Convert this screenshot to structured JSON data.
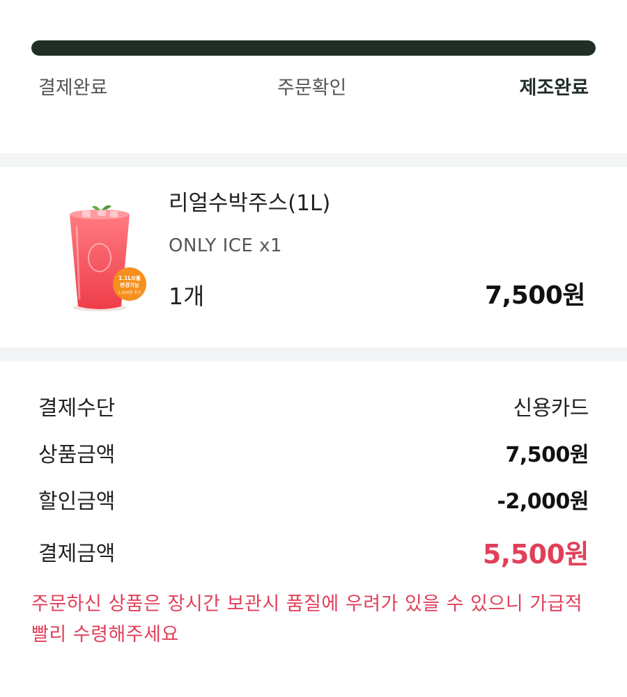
{
  "progress": {
    "value": 1.0,
    "steps": [
      "결제완료",
      "주문확인",
      "제조완료"
    ],
    "active_step": 2
  },
  "order_item": {
    "name": "리얼수박주스(1L)",
    "option": "ONLY ICE x1",
    "quantity": "1개",
    "price": "7,500원",
    "badge_lines": [
      "1.1L보틀",
      "변경가능",
      "1,800원 추가"
    ]
  },
  "payment": {
    "method": {
      "label": "결제수단",
      "value": "신용카드"
    },
    "subtotal": {
      "label": "상품금액",
      "value": "7,500원"
    },
    "discount": {
      "label": "할인금액",
      "value": "-2,000원"
    },
    "total": {
      "label": "결제금액",
      "value": "5,500원"
    },
    "notice": "주문하신 상품은 장시간 보관시 품질에 우려가 있을 수 있으니 가급적 빨리 수령해주세요"
  },
  "colors": {
    "progress": "#1f2f26",
    "accent_red": "#e0405a",
    "divider": "#f2f4f5"
  }
}
